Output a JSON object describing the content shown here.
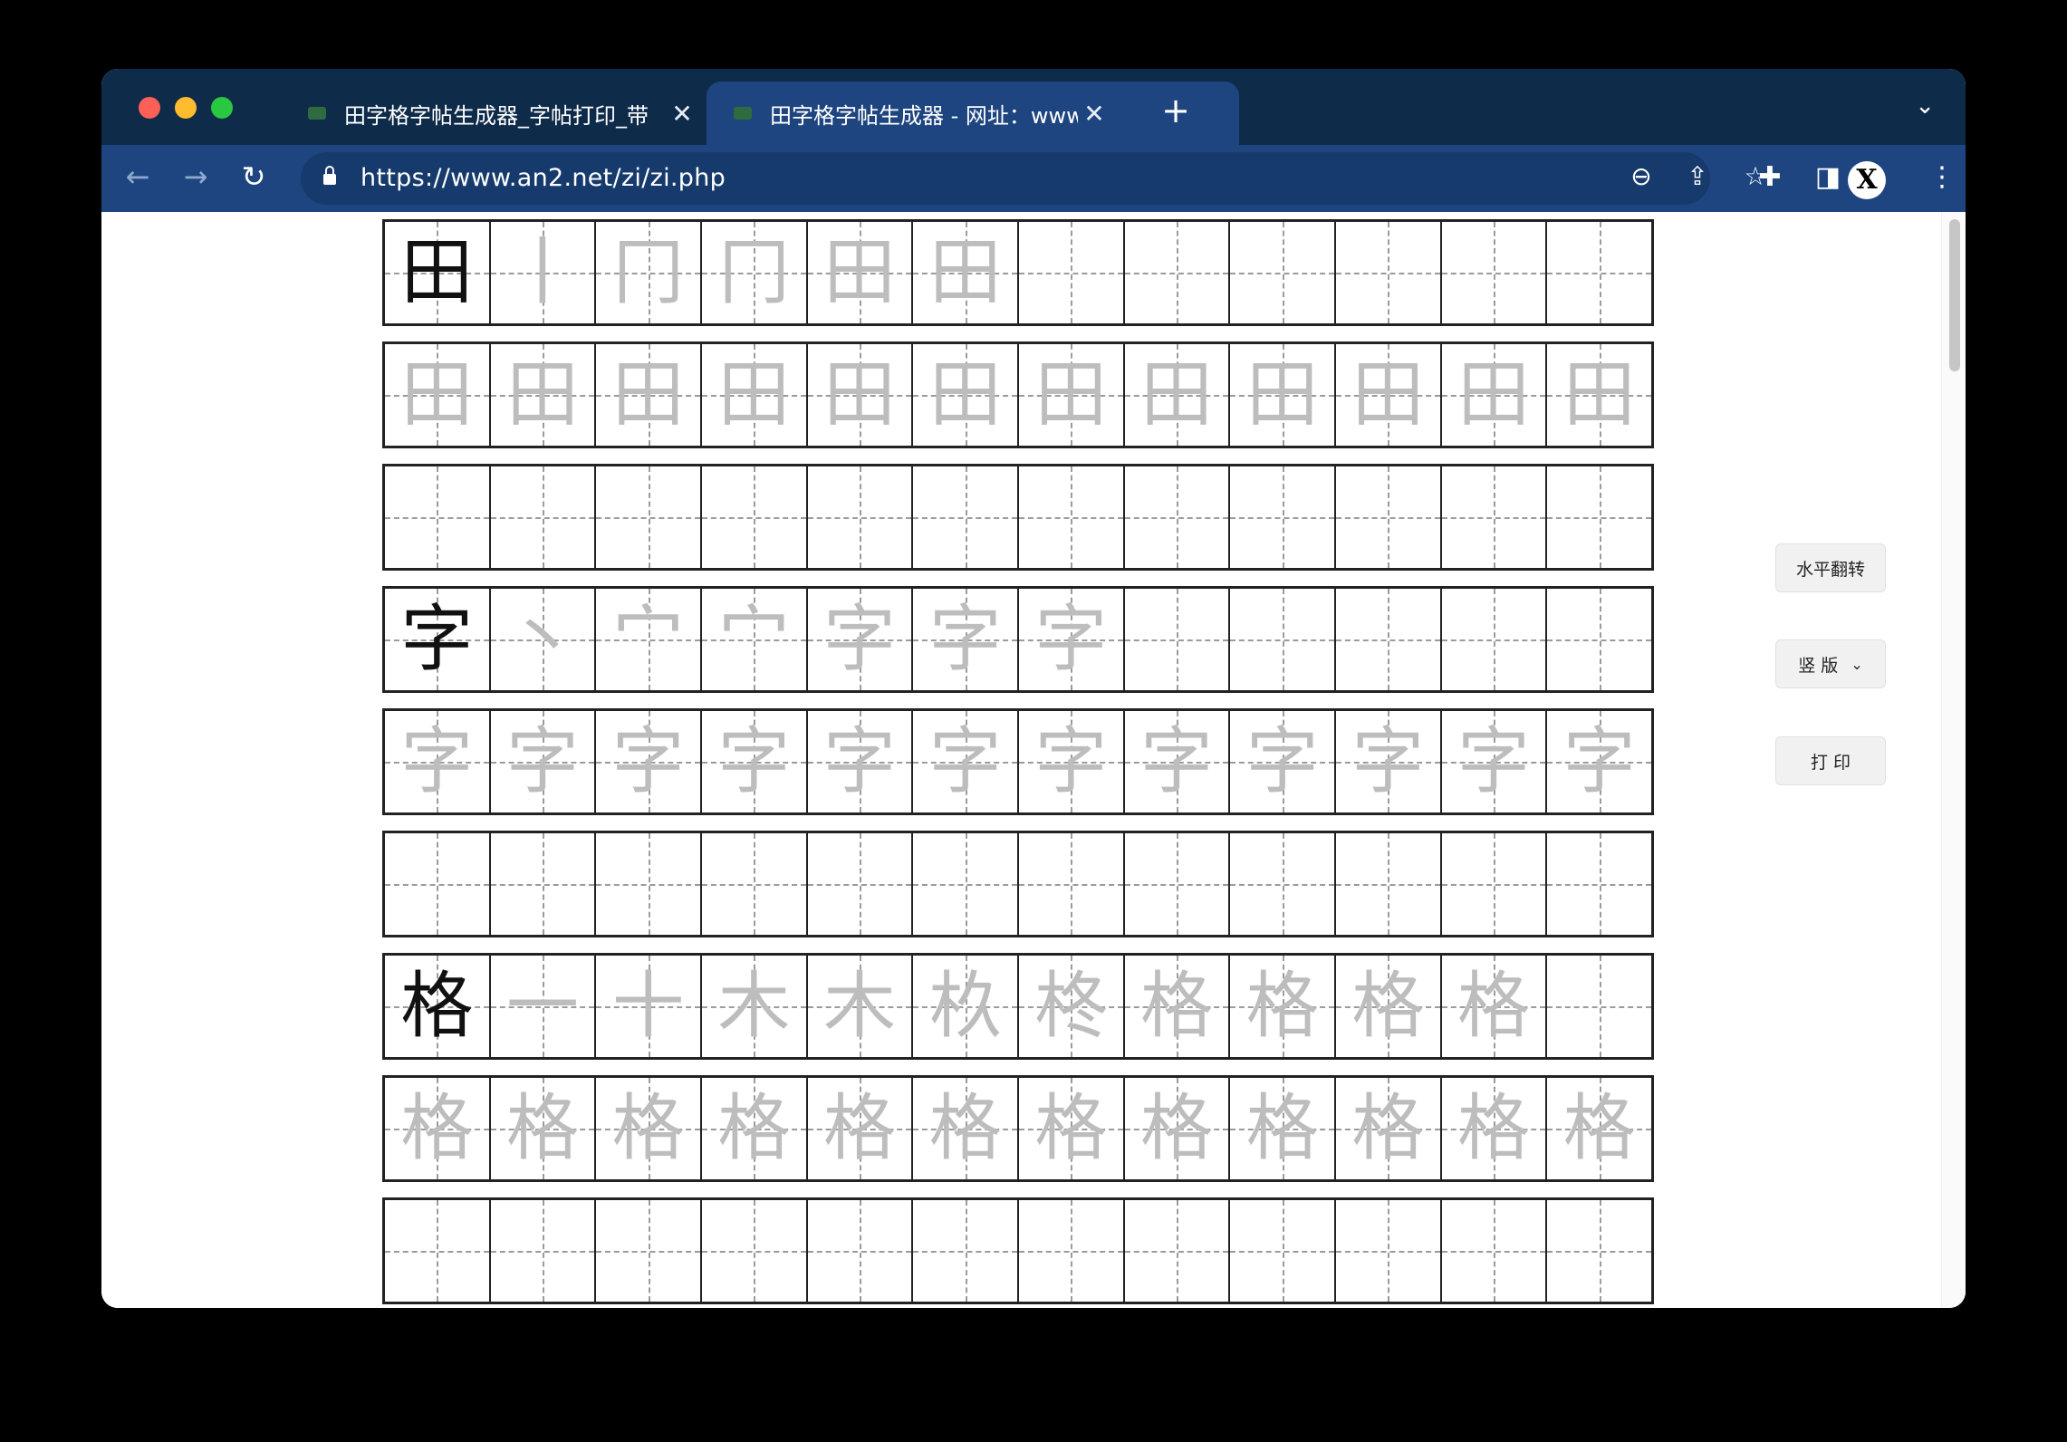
{
  "browser": {
    "tabs": [
      {
        "title": "田字格字帖生成器_字帖打印_带",
        "active": false
      },
      {
        "title": "田字格字帖生成器 - 网址：www",
        "active": true
      }
    ],
    "new_tab_symbol": "+",
    "tab_close_symbol": "✕",
    "url": "https://www.an2.net/zi/zi.php",
    "profile_initial": "X",
    "colors": {
      "titlebar": "#0f2b4a",
      "toolbar": "#1e4580"
    }
  },
  "controls": {
    "flip_label": "水平翻转",
    "layout_select_value": "竖 版",
    "print_label": "打 印"
  },
  "grid": {
    "columns": 12,
    "rows": [
      {
        "type": "strokes",
        "chars": [
          "田",
          "丨",
          "冂",
          "冂",
          "田",
          "田",
          "",
          "",
          "",
          "",
          "",
          ""
        ]
      },
      {
        "type": "trace",
        "chars": [
          "田",
          "田",
          "田",
          "田",
          "田",
          "田",
          "田",
          "田",
          "田",
          "田",
          "田",
          "田"
        ]
      },
      {
        "type": "blank",
        "chars": [
          "",
          "",
          "",
          "",
          "",
          "",
          "",
          "",
          "",
          "",
          "",
          ""
        ]
      },
      {
        "type": "strokes",
        "chars": [
          "字",
          "丶",
          "宀",
          "宀",
          "字",
          "字",
          "字",
          "",
          "",
          "",
          "",
          ""
        ]
      },
      {
        "type": "trace",
        "chars": [
          "字",
          "字",
          "字",
          "字",
          "字",
          "字",
          "字",
          "字",
          "字",
          "字",
          "字",
          "字"
        ]
      },
      {
        "type": "blank",
        "chars": [
          "",
          "",
          "",
          "",
          "",
          "",
          "",
          "",
          "",
          "",
          "",
          ""
        ]
      },
      {
        "type": "strokes",
        "chars": [
          "格",
          "一",
          "十",
          "木",
          "木",
          "杦",
          "柊",
          "格",
          "格",
          "格",
          "格",
          ""
        ]
      },
      {
        "type": "trace",
        "chars": [
          "格",
          "格",
          "格",
          "格",
          "格",
          "格",
          "格",
          "格",
          "格",
          "格",
          "格",
          "格"
        ]
      },
      {
        "type": "blank",
        "chars": [
          "",
          "",
          "",
          "",
          "",
          "",
          "",
          "",
          "",
          "",
          "",
          ""
        ]
      }
    ]
  }
}
